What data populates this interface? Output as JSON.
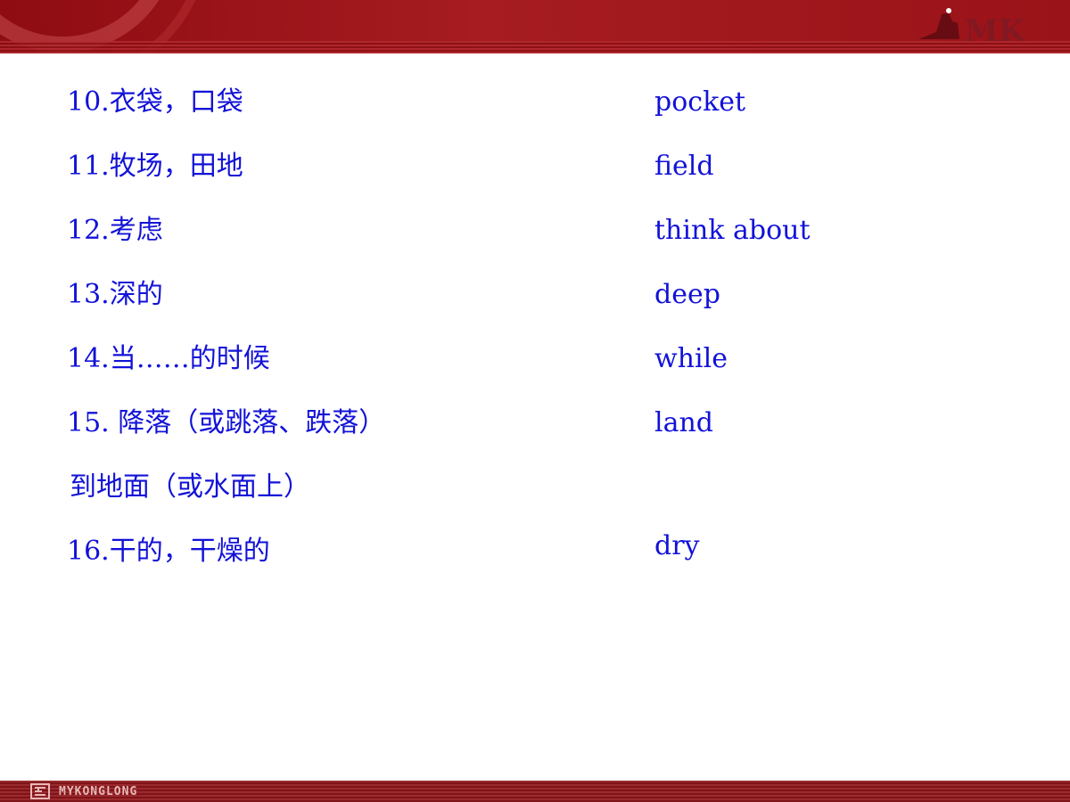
{
  "colors": {
    "banner_red": "#9a1318",
    "text_blue": "#1212d8",
    "background": "#ffffff"
  },
  "header": {
    "logo_text": "MK"
  },
  "footer": {
    "logo_text": "MYKONGLONG"
  },
  "vocab": [
    {
      "cn": "10.衣袋，口袋",
      "en": "pocket"
    },
    {
      "cn": "11.牧场，田地",
      "en": "field"
    },
    {
      "cn": "12.考虑",
      "en": "think about"
    },
    {
      "cn": "13.深的",
      "en": "deep"
    },
    {
      "cn": "14.当……的时候",
      "en": "while"
    },
    {
      "cn": "15. 降落（或跳落、跌落）",
      "en": "land"
    },
    {
      "cn": " 到地面（或水面上）",
      "en": ""
    },
    {
      "cn": "16.干的，干燥的",
      "en": "dry"
    }
  ]
}
